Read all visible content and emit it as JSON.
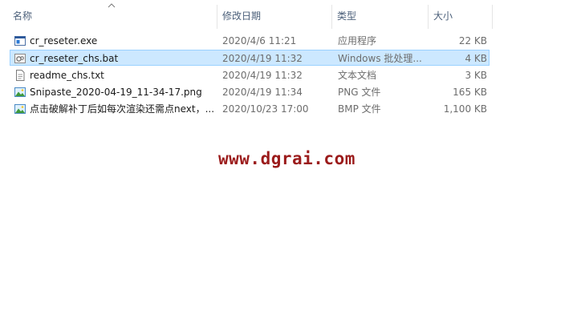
{
  "header": {
    "name": "名称",
    "date": "修改日期",
    "type": "类型",
    "size": "大小"
  },
  "files": [
    {
      "name": "cr_reseter.exe",
      "date": "2020/4/6 11:21",
      "type": "应用程序",
      "size": "22 KB",
      "icon": "exe-icon",
      "selected": false
    },
    {
      "name": "cr_reseter_chs.bat",
      "date": "2020/4/19 11:32",
      "type": "Windows 批处理...",
      "size": "4 KB",
      "icon": "bat-icon",
      "selected": true
    },
    {
      "name": "readme_chs.txt",
      "date": "2020/4/19 11:32",
      "type": "文本文档",
      "size": "3 KB",
      "icon": "txt-icon",
      "selected": false
    },
    {
      "name": "Snipaste_2020-04-19_11-34-17.png",
      "date": "2020/4/19 11:34",
      "type": "PNG 文件",
      "size": "165 KB",
      "icon": "image-icon",
      "selected": false
    },
    {
      "name": "点击破解补丁后如每次渲染还需点next，...",
      "date": "2020/10/23 17:00",
      "type": "BMP 文件",
      "size": "1,100 KB",
      "icon": "image-icon",
      "selected": false
    }
  ],
  "watermark": "www.dgrai.com",
  "colors": {
    "selection_bg": "#cce8ff",
    "selection_border": "#99d1ff",
    "header_text": "#4c607a",
    "watermark": "#9b1b1b"
  }
}
